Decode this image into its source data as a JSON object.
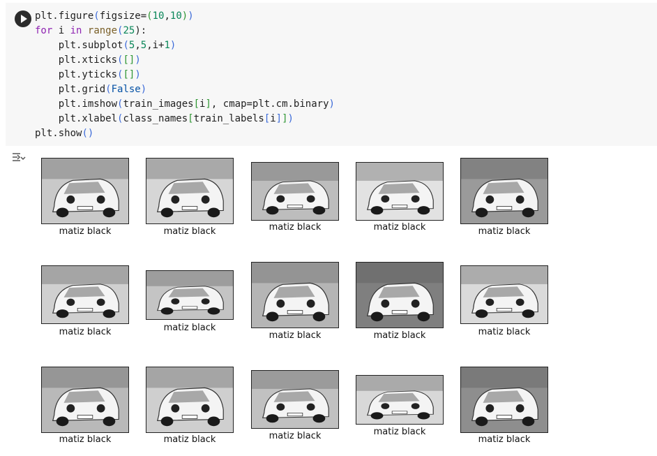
{
  "cell": {
    "code_lines": [
      [
        {
          "t": "plt.figure",
          "c": ""
        },
        {
          "t": "(",
          "c": "br"
        },
        {
          "t": "figsize=",
          "c": ""
        },
        {
          "t": "(",
          "c": "br2"
        },
        {
          "t": "10",
          "c": "num"
        },
        {
          "t": ",",
          "c": ""
        },
        {
          "t": "10",
          "c": "num"
        },
        {
          "t": ")",
          "c": "br2"
        },
        {
          "t": ")",
          "c": "br"
        }
      ],
      [
        {
          "t": "for",
          "c": "kw"
        },
        {
          "t": " i ",
          "c": ""
        },
        {
          "t": "in",
          "c": "kw"
        },
        {
          "t": " ",
          "c": ""
        },
        {
          "t": "range",
          "c": "bi"
        },
        {
          "t": "(",
          "c": "br"
        },
        {
          "t": "25",
          "c": "num"
        },
        {
          "t": "):",
          "c": ""
        }
      ],
      [
        {
          "t": "    plt.subplot",
          "c": ""
        },
        {
          "t": "(",
          "c": "br"
        },
        {
          "t": "5",
          "c": "num"
        },
        {
          "t": ",",
          "c": ""
        },
        {
          "t": "5",
          "c": "num"
        },
        {
          "t": ",i+",
          "c": ""
        },
        {
          "t": "1",
          "c": "num"
        },
        {
          "t": ")",
          "c": "br"
        }
      ],
      [
        {
          "t": "    plt.xticks",
          "c": ""
        },
        {
          "t": "(",
          "c": "br"
        },
        {
          "t": "[]",
          "c": "br2"
        },
        {
          "t": ")",
          "c": "br"
        }
      ],
      [
        {
          "t": "    plt.yticks",
          "c": ""
        },
        {
          "t": "(",
          "c": "br"
        },
        {
          "t": "[]",
          "c": "br2"
        },
        {
          "t": ")",
          "c": "br"
        }
      ],
      [
        {
          "t": "    plt.grid",
          "c": ""
        },
        {
          "t": "(",
          "c": "br"
        },
        {
          "t": "False",
          "c": "const"
        },
        {
          "t": ")",
          "c": "br"
        }
      ],
      [
        {
          "t": "    plt.imshow",
          "c": ""
        },
        {
          "t": "(",
          "c": "br"
        },
        {
          "t": "train_images",
          "c": ""
        },
        {
          "t": "[",
          "c": "br2"
        },
        {
          "t": "i",
          "c": ""
        },
        {
          "t": "]",
          "c": "br2"
        },
        {
          "t": ", cmap=plt.cm.binary",
          "c": ""
        },
        {
          "t": ")",
          "c": "br"
        }
      ],
      [
        {
          "t": "    plt.xlabel",
          "c": ""
        },
        {
          "t": "(",
          "c": "br"
        },
        {
          "t": "class_names",
          "c": ""
        },
        {
          "t": "[",
          "c": "br2"
        },
        {
          "t": "train_labels",
          "c": ""
        },
        {
          "t": "[",
          "c": "br"
        },
        {
          "t": "i",
          "c": ""
        },
        {
          "t": "]",
          "c": "br"
        },
        {
          "t": "]",
          "c": "br2"
        },
        {
          "t": ")",
          "c": "br"
        }
      ],
      [
        {
          "t": "plt.show",
          "c": ""
        },
        {
          "t": "()",
          "c": "br"
        }
      ]
    ]
  },
  "output": {
    "images": [
      {
        "label": "matiz black"
      },
      {
        "label": "matiz black"
      },
      {
        "label": "matiz black"
      },
      {
        "label": "matiz black"
      },
      {
        "label": "matiz black"
      },
      {
        "label": "matiz black"
      },
      {
        "label": "matiz black"
      },
      {
        "label": "matiz black"
      },
      {
        "label": "matiz black"
      },
      {
        "label": "matiz black"
      },
      {
        "label": "matiz black"
      },
      {
        "label": "matiz black"
      },
      {
        "label": "matiz black"
      },
      {
        "label": "matiz black"
      },
      {
        "label": "matiz black"
      }
    ]
  },
  "icons": {
    "run": "play-circle-icon",
    "output_toggle": "output-toggle-icon"
  }
}
